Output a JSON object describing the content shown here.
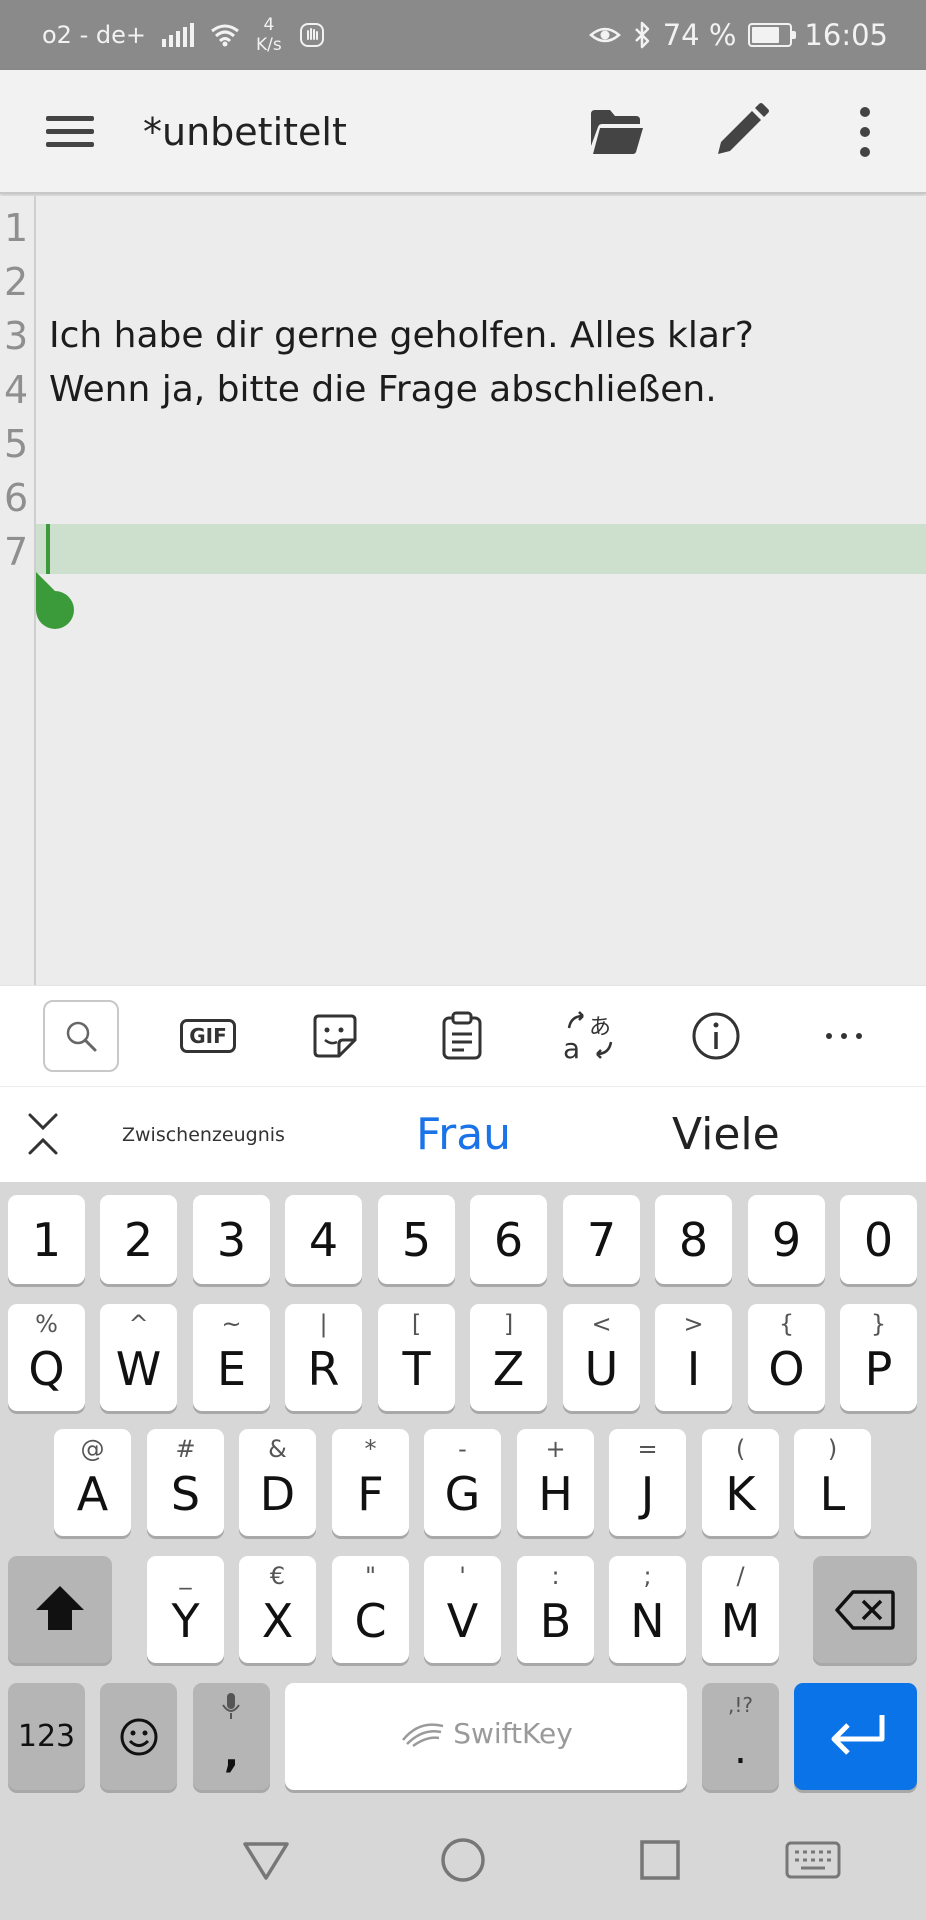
{
  "status_bar": {
    "carrier": "o2 - de+",
    "net_speed_value": "4",
    "net_speed_unit": "K/s",
    "battery": "74 %",
    "time": "16:05",
    "icons": [
      "signal-icon",
      "wifi-icon",
      "hand-icon",
      "eye-icon",
      "bluetooth-icon",
      "battery-icon"
    ]
  },
  "app_bar": {
    "title": "*unbetitelt",
    "actions": [
      "menu-icon",
      "folder-icon",
      "pencil-icon",
      "more-icon"
    ]
  },
  "editor": {
    "lines": [
      {
        "number": "1",
        "text": ""
      },
      {
        "number": "2",
        "text": ""
      },
      {
        "number": "3",
        "text": "Ich habe dir gerne geholfen. Alles klar?"
      },
      {
        "number": "4",
        "text": "Wenn ja, bitte die Frage abschließen."
      },
      {
        "number": "5",
        "text": ""
      },
      {
        "number": "6",
        "text": ""
      },
      {
        "number": "7",
        "text": ""
      }
    ],
    "current_line": 7,
    "highlight_color": "#cde0cd",
    "caret_color": "#3b9b3b"
  },
  "keyboard_toolbar": {
    "gif_label": "GIF",
    "items": [
      "search-icon",
      "gif-icon",
      "sticker-icon",
      "clipboard-icon",
      "translate-icon",
      "info-icon",
      "more-icon"
    ]
  },
  "suggestions": [
    "Zwischenzeugnis",
    "Frau",
    "Viele"
  ],
  "keyboard": {
    "number_row": [
      "1",
      "2",
      "3",
      "4",
      "5",
      "6",
      "7",
      "8",
      "9",
      "0"
    ],
    "row1": [
      {
        "main": "Q",
        "sec": "%"
      },
      {
        "main": "W",
        "sec": "^"
      },
      {
        "main": "E",
        "sec": "~"
      },
      {
        "main": "R",
        "sec": "|"
      },
      {
        "main": "T",
        "sec": "["
      },
      {
        "main": "Z",
        "sec": "]"
      },
      {
        "main": "U",
        "sec": "<"
      },
      {
        "main": "I",
        "sec": ">"
      },
      {
        "main": "O",
        "sec": "{"
      },
      {
        "main": "P",
        "sec": "}"
      }
    ],
    "row2": [
      {
        "main": "A",
        "sec": "@"
      },
      {
        "main": "S",
        "sec": "#"
      },
      {
        "main": "D",
        "sec": "&"
      },
      {
        "main": "F",
        "sec": "*"
      },
      {
        "main": "G",
        "sec": "-"
      },
      {
        "main": "H",
        "sec": "+"
      },
      {
        "main": "J",
        "sec": "="
      },
      {
        "main": "K",
        "sec": "("
      },
      {
        "main": "L",
        "sec": ")"
      }
    ],
    "row3": [
      {
        "main": "Y",
        "sec": "_"
      },
      {
        "main": "X",
        "sec": "€"
      },
      {
        "main": "C",
        "sec": "\""
      },
      {
        "main": "V",
        "sec": "'"
      },
      {
        "main": "B",
        "sec": ":"
      },
      {
        "main": "N",
        "sec": ";"
      },
      {
        "main": "M",
        "sec": "/"
      }
    ],
    "bottom": {
      "numbers_label": "123",
      "comma_label": ",",
      "space_label": "SwiftKey",
      "period_secondary": ",!?",
      "period_label": "."
    },
    "accent_color": "#0a73e8"
  },
  "nav_bar": {
    "buttons": [
      "back-icon",
      "home-icon",
      "recents-icon",
      "keyboard-icon"
    ]
  }
}
